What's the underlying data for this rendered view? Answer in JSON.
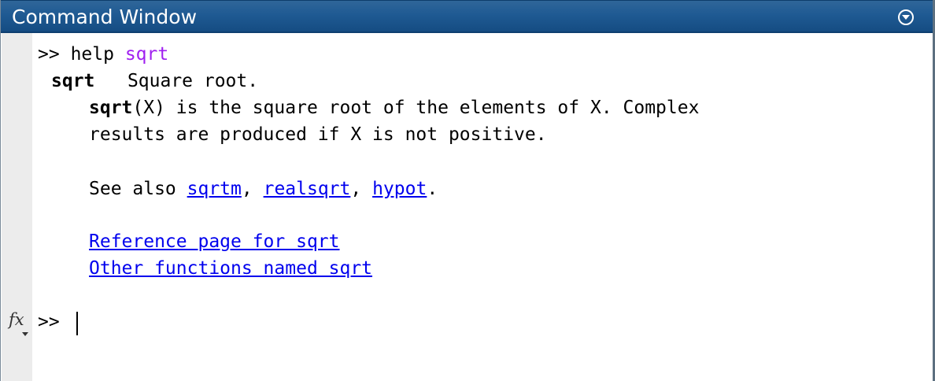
{
  "window": {
    "title": "Command Window"
  },
  "command": {
    "prompt": ">>",
    "keyword": "help",
    "argument": "sqrt"
  },
  "help": {
    "name": "sqrt",
    "summary": "Square root.",
    "desc_fn": "sqrt",
    "desc_line1_rest": "(X) is the square root of the elements of X. Complex",
    "desc_line2": "results are produced if X is not positive.",
    "see_also_label": "See also",
    "see_also": [
      "sqrtm",
      "realsqrt",
      "hypot"
    ],
    "reference_link": "Reference page for sqrt",
    "other_link": "Other functions named sqrt"
  },
  "prompt_line": {
    "fx_label": "fx",
    "prompt": ">>"
  },
  "icons": {
    "menu": "circle-chevron-down-icon",
    "function_browser": "fx-icon"
  }
}
